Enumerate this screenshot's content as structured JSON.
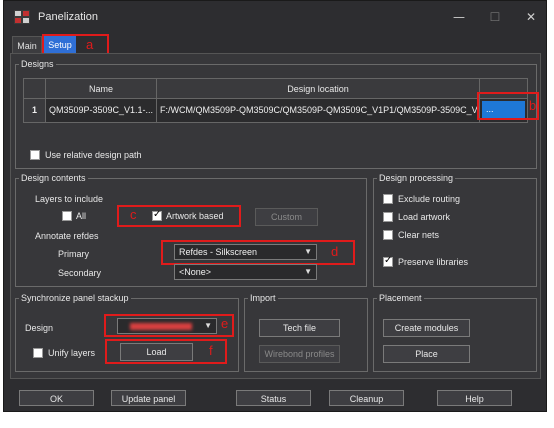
{
  "window": {
    "title": "Panelization",
    "minimize": "—",
    "maximize": "☐",
    "close": "✕"
  },
  "tabs": {
    "main": "Main",
    "setup": "Setup"
  },
  "annotations": {
    "a": "a",
    "b": "b",
    "c": "c",
    "d": "d",
    "e": "e",
    "f": "f"
  },
  "designs": {
    "group_label": "Designs",
    "col_name": "Name",
    "col_location": "Design location",
    "row_index": "1",
    "row_name": "QM3509P-3509C_V1.1-...",
    "row_location": "F:/WCM/QM3509P-QM3509C/QM3509P-QM3509C_V1P1/QM3509P-3509C_V...",
    "browse_label": "...",
    "use_relative_label": "Use relative design path",
    "use_relative_checked": false
  },
  "design_contents": {
    "group_label": "Design contents",
    "layers_label": "Layers to include",
    "all_label": "All",
    "all_checked": false,
    "artwork_label": "Artwork based",
    "artwork_checked": true,
    "custom_label": "Custom",
    "annotate_label": "Annotate refdes",
    "primary_label": "Primary",
    "primary_value": "Refdes - Silkscreen",
    "secondary_label": "Secondary",
    "secondary_value": "<None>"
  },
  "design_processing": {
    "group_label": "Design processing",
    "exclude_routing": "Exclude routing",
    "load_artwork": "Load artwork",
    "clear_nets": "Clear nets",
    "preserve_libraries": "Preserve libraries",
    "preserve_checked": true
  },
  "sync_stackup": {
    "group_label": "Synchronize panel stackup",
    "design_label": "Design",
    "design_value": "",
    "unify_label": "Unify layers",
    "load_label": "Load"
  },
  "import": {
    "group_label": "Import",
    "tech_file": "Tech file",
    "wirebond": "Wirebond profiles"
  },
  "placement": {
    "group_label": "Placement",
    "create_modules": "Create modules",
    "place": "Place"
  },
  "footer": {
    "ok": "OK",
    "update_panel": "Update panel",
    "status": "Status",
    "cleanup": "Cleanup",
    "help": "Help"
  },
  "colors": {
    "annotation_red": "#e01b1b",
    "tab_active": "#2f6fd6",
    "selected_cell": "#1e78d7"
  }
}
